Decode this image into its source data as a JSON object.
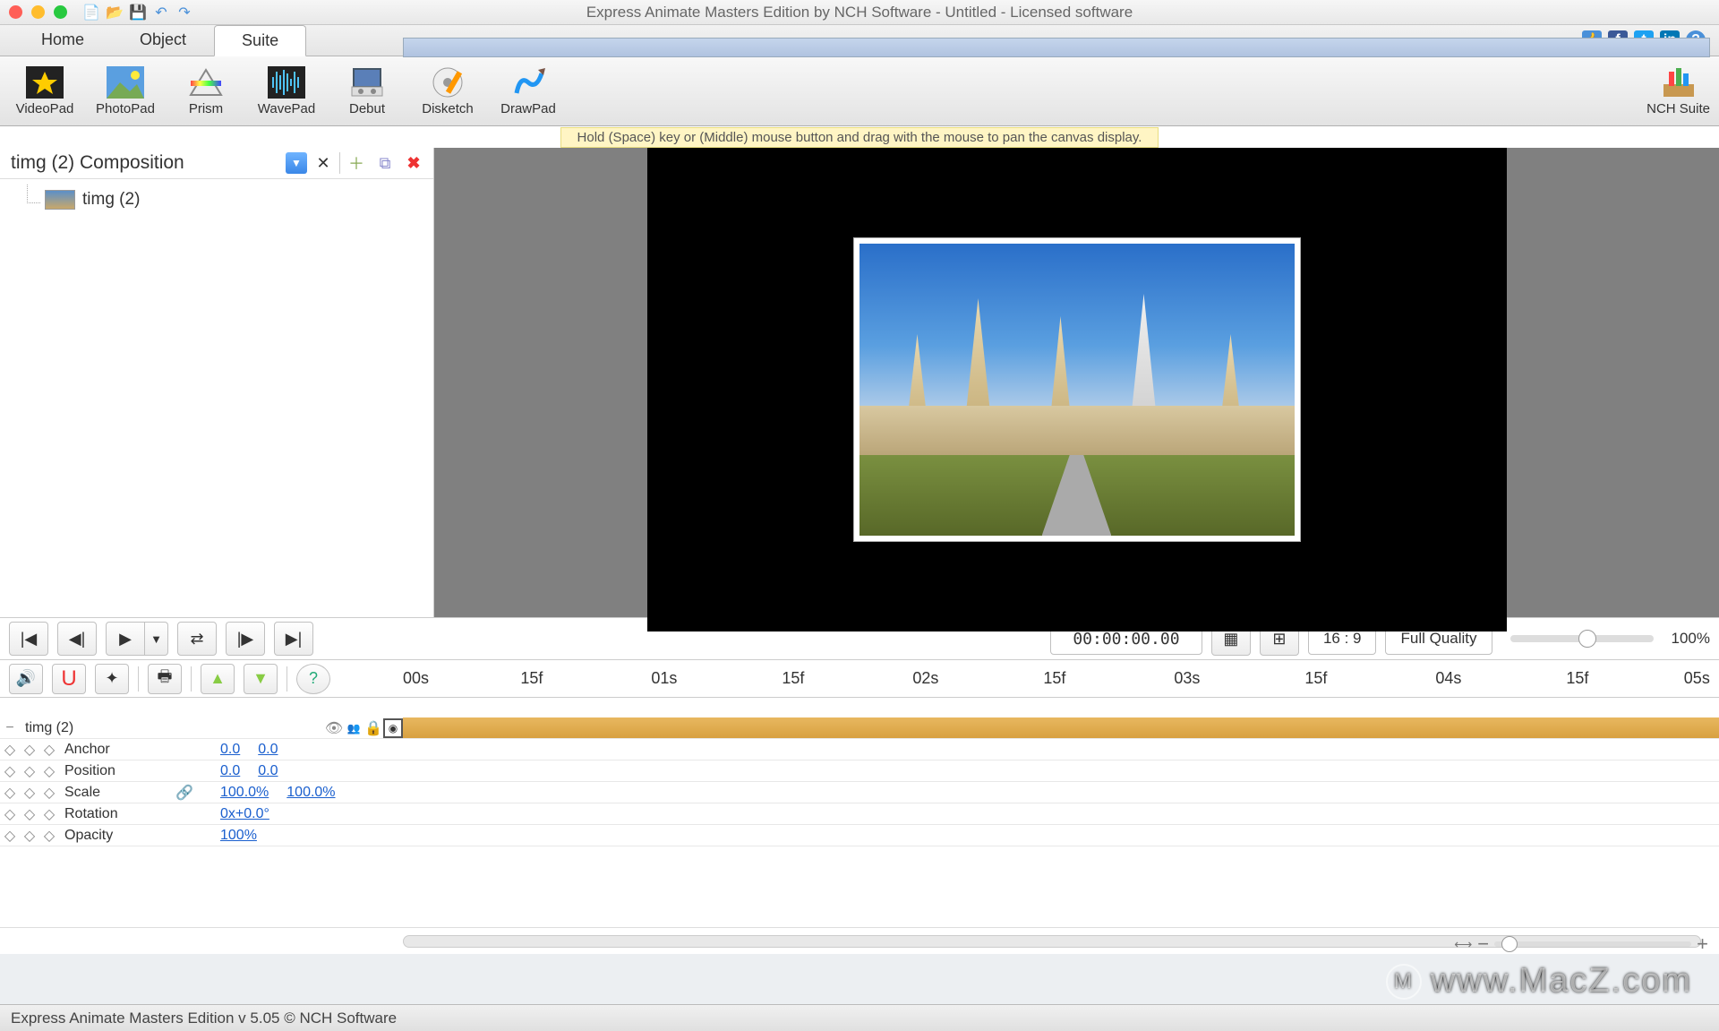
{
  "window": {
    "title": "Express Animate Masters Edition by NCH Software - Untitled - Licensed software"
  },
  "tabs": {
    "home": "Home",
    "object": "Object",
    "suite": "Suite"
  },
  "toolbar": {
    "videopad": "VideoPad",
    "photopad": "PhotoPad",
    "prism": "Prism",
    "wavepad": "WavePad",
    "debut": "Debut",
    "disketch": "Disketch",
    "drawpad": "DrawPad",
    "nchsuite": "NCH Suite"
  },
  "hint": "Hold (Space) key or (Middle) mouse button and drag with the mouse to pan the canvas display.",
  "composition": {
    "name": "timg (2) Composition",
    "layer": "timg (2)"
  },
  "playback": {
    "timecode": "00:00:00.00",
    "aspect": "16 : 9",
    "quality": "Full Quality",
    "zoom": "100%"
  },
  "ruler": {
    "t0": "00s",
    "t1": "15f",
    "t2": "01s",
    "t3": "15f",
    "t4": "02s",
    "t5": "15f",
    "t6": "03s",
    "t7": "15f",
    "t8": "04s",
    "t9": "15f",
    "t10": "05s"
  },
  "layer": {
    "name": "timg (2)"
  },
  "props": {
    "anchor_label": "Anchor",
    "anchor_x": "0.0",
    "anchor_y": "0.0",
    "position_label": "Position",
    "position_x": "0.0",
    "position_y": "0.0",
    "scale_label": "Scale",
    "scale_x": "100.0%",
    "scale_y": "100.0%",
    "rotation_label": "Rotation",
    "rotation_v": "0x+0.0°",
    "opacity_label": "Opacity",
    "opacity_v": "100%"
  },
  "status": "Express Animate Masters Edition v 5.05 © NCH Software",
  "watermark": "www.MacZ.com"
}
